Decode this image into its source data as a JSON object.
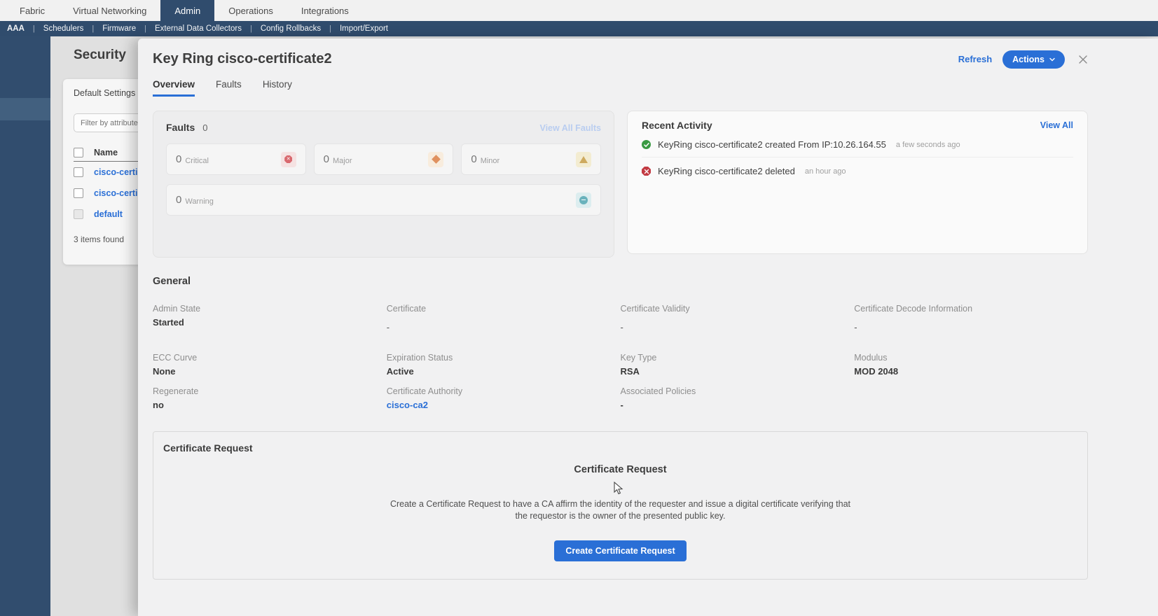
{
  "top_nav": {
    "items": [
      "Fabric",
      "Virtual Networking",
      "Admin",
      "Operations",
      "Integrations"
    ]
  },
  "sub_nav": {
    "separator": "|",
    "items": [
      "AAA",
      "Schedulers",
      "Firmware",
      "External Data Collectors",
      "Config Rollbacks",
      "Import/Export"
    ]
  },
  "security_page": {
    "title": "Security",
    "tab_label": "Default Settings",
    "filter_placeholder": "Filter by attribute",
    "table": {
      "name_header": "Name",
      "rows": [
        "cisco-certi",
        "cisco-certi",
        "default"
      ]
    },
    "items_found": "3 items found"
  },
  "panel": {
    "title": "Key Ring cisco-certificate2",
    "refresh_label": "Refresh",
    "actions_label": "Actions",
    "tabs": [
      "Overview",
      "Faults",
      "History"
    ],
    "faults": {
      "title": "Faults",
      "count": "0",
      "view_all_label": "View All Faults",
      "stats": [
        {
          "value": "0",
          "label": "Critical"
        },
        {
          "value": "0",
          "label": "Major"
        },
        {
          "value": "0",
          "label": "Minor"
        },
        {
          "value": "0",
          "label": "Warning"
        }
      ]
    },
    "recent_activity": {
      "title": "Recent Activity",
      "view_all_label": "View All",
      "items": [
        {
          "text": "KeyRing cisco-certificate2 created From IP:10.26.164.55",
          "time": "a few seconds ago",
          "status": "success"
        },
        {
          "text": "KeyRing cisco-certificate2 deleted",
          "time": "an hour ago",
          "status": "error"
        }
      ]
    },
    "general": {
      "title": "General",
      "fields": [
        {
          "label": "Admin State",
          "value": "Started"
        },
        {
          "label": "Certificate",
          "value": "-"
        },
        {
          "label": "Certificate Validity",
          "value": "-"
        },
        {
          "label": "Certificate Decode Information",
          "value": "-"
        },
        {
          "label": "ECC Curve",
          "value": "None"
        },
        {
          "label": "Expiration Status",
          "value": "Active"
        },
        {
          "label": "Key Type",
          "value": "RSA"
        },
        {
          "label": "Modulus",
          "value": "MOD 2048"
        },
        {
          "label": "Regenerate",
          "value": "no"
        },
        {
          "label": "Certificate Authority",
          "value": "cisco-ca2"
        },
        {
          "label": "Associated Policies",
          "value": "-"
        }
      ]
    },
    "certificate_request": {
      "box_title": "Certificate Request",
      "heading": "Certificate Request",
      "description": "Create a Certificate Request to have a CA affirm the identity of the requester and issue a digital certificate verifying that the requestor is the owner of the presented public key.",
      "button_label": "Create Certificate Request"
    }
  },
  "colors": {
    "accent_blue": "#2a6fd6",
    "navy": "#304c6d",
    "critical_red": "#d4484f",
    "major_orange": "#dd7b3c",
    "minor_amber": "#c79a3c",
    "warning_teal": "#49a4b0",
    "success_green": "#3a9a43",
    "error_red": "#c23b43"
  }
}
